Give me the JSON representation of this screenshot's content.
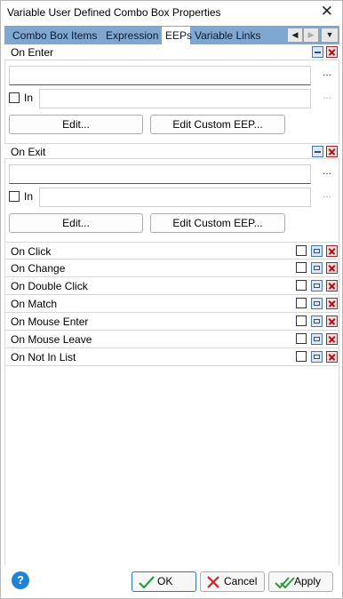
{
  "window": {
    "title": "Variable User Defined Combo Box Properties",
    "close_glyph": "✕"
  },
  "tabs": [
    {
      "label": "Combo Box Items",
      "active": false
    },
    {
      "label": "Expression",
      "active": false
    },
    {
      "label": "EEPs",
      "active": true
    },
    {
      "label": "Variable Links",
      "active": false
    }
  ],
  "tab_nav": {
    "left_glyph": "◀",
    "right_glyph": "▶",
    "menu_glyph": "▼"
  },
  "sections": [
    {
      "label": "On Enter",
      "main_value": "",
      "in_label": "In",
      "in_value": "",
      "edit_label": "Edit...",
      "edit_custom_label": "Edit Custom EEP...",
      "dots": "..."
    },
    {
      "label": "On Exit",
      "main_value": "",
      "in_label": "In",
      "in_value": "",
      "edit_label": "Edit...",
      "edit_custom_label": "Edit Custom EEP...",
      "dots": "..."
    }
  ],
  "events": [
    {
      "label": "On Click"
    },
    {
      "label": "On Change"
    },
    {
      "label": "On Double Click"
    },
    {
      "label": "On Match"
    },
    {
      "label": "On Mouse Enter"
    },
    {
      "label": "On Mouse Leave"
    },
    {
      "label": "On Not In List"
    }
  ],
  "footer": {
    "help_glyph": "?",
    "ok_label": "OK",
    "cancel_label": "Cancel",
    "apply_label": "Apply",
    "ok_icon": "checkmark-icon",
    "cancel_icon": "red-x-icon",
    "apply_icon": "double-checkmark-icon",
    "colors": {
      "ok_check": "#2e9a3a",
      "cancel_x": "#d42020",
      "help": "#1e83d6"
    }
  }
}
